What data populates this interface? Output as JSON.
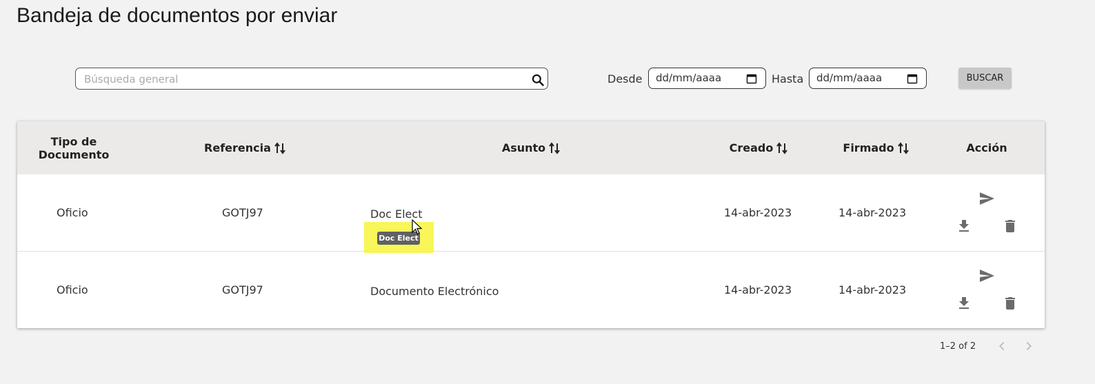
{
  "page": {
    "title": "Bandeja de documentos por enviar"
  },
  "search": {
    "placeholder": "Búsqueda general",
    "value": "",
    "button_label": "BUSCAR"
  },
  "filters": {
    "from_label": "Desde",
    "from_value": "dd/mm/aaaa",
    "to_label": "Hasta",
    "to_value": "dd/mm/aaaa"
  },
  "table": {
    "headers": {
      "tipo": "Tipo de Documento",
      "referencia": "Referencia",
      "asunto": "Asunto",
      "creado": "Creado",
      "firmado": "Firmado",
      "accion": "Acción"
    },
    "rows": [
      {
        "tipo": "Oficio",
        "referencia": "GOTJ97",
        "asunto": "Doc Elect",
        "creado": "14-abr-2023",
        "firmado": "14-abr-2023"
      },
      {
        "tipo": "Oficio",
        "referencia": "GOTJ97",
        "asunto": "Documento Electrónico",
        "creado": "14-abr-2023",
        "firmado": "14-abr-2023"
      }
    ]
  },
  "tooltip": {
    "text": "Doc Elect"
  },
  "pagination": {
    "range": "1–2 of 2"
  },
  "icons": [
    "search-icon",
    "calendar-icon",
    "sort-icon",
    "send-icon",
    "download-icon",
    "delete-icon",
    "chevron-left-icon",
    "chevron-right-icon"
  ],
  "colors": {
    "background": "#f2f2f2",
    "header_bg": "#ebeae8",
    "icon": "#6b6b6b",
    "button_bg": "#c8c8c8",
    "highlight": "#f7f53c",
    "tooltip_bg": "#616161"
  }
}
